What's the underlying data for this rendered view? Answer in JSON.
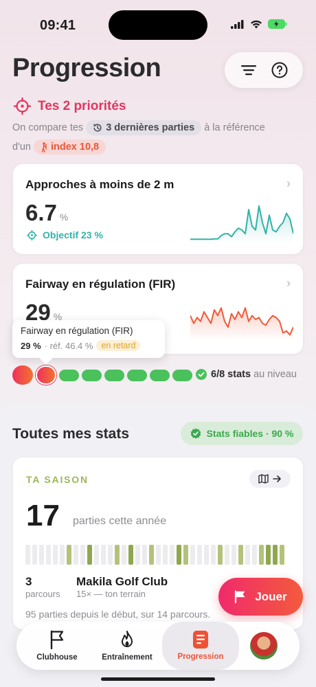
{
  "status": {
    "time": "09:41"
  },
  "header": {
    "title": "Progression"
  },
  "priorities": {
    "title": "Tes 2 priorités",
    "desc_prefix": "On compare tes",
    "recent_chip": "3 dernières parties",
    "desc_middle": "à la référence",
    "desc_line2": "d'un",
    "index_chip": "index 10,8"
  },
  "card1": {
    "title": "Approches à moins de 2 m",
    "value": "6.7",
    "unit": "%",
    "goal": "Objectif 23 %",
    "spark": [
      0.05,
      0.05,
      0.05,
      0.05,
      0.05,
      0.05,
      0.05,
      0.06,
      0.06,
      0.15,
      0.2,
      0.2,
      0.12,
      0.25,
      0.35,
      0.3,
      0.2,
      0.85,
      0.4,
      0.3,
      0.95,
      0.5,
      0.2,
      0.7,
      0.3,
      0.25,
      0.4,
      0.5,
      0.75,
      0.6,
      0.2
    ],
    "spark_color": "#2fb3a6"
  },
  "card2": {
    "title": "Fairway en régulation (FIR)",
    "value": "29",
    "unit": "%",
    "spark": [
      0.6,
      0.4,
      0.55,
      0.45,
      0.7,
      0.55,
      0.4,
      0.75,
      0.6,
      0.8,
      0.45,
      0.3,
      0.65,
      0.5,
      0.7,
      0.55,
      0.8,
      0.45,
      0.6,
      0.5,
      0.55,
      0.4,
      0.35,
      0.5,
      0.6,
      0.55,
      0.45,
      0.15,
      0.2,
      0.1,
      0.3
    ],
    "spark_color": "#ef5a3a"
  },
  "tooltip": {
    "title": "Fairway en régulation (FIR)",
    "value": "29 %",
    "ref": "· réf. 46.4 %",
    "status": "en retard"
  },
  "progress": {
    "statuses": [
      "bad",
      "bad",
      "good",
      "good",
      "good",
      "good",
      "good",
      "good"
    ],
    "label_bold": "6/8 stats",
    "label_rest": "au niveau"
  },
  "stats": {
    "title": "Toutes mes stats",
    "reliable": "Stats fiables · 90 %"
  },
  "season": {
    "label": "TA SAISON",
    "count": "17",
    "count_label": "parties cette année",
    "bars": [
      0,
      0,
      0,
      0,
      0,
      0,
      1,
      0,
      0,
      2,
      0,
      0,
      0,
      1,
      0,
      2,
      0,
      0,
      1,
      0,
      0,
      0,
      2,
      1,
      0,
      0,
      0,
      0,
      1,
      0,
      0,
      1,
      0,
      0,
      1,
      2,
      2,
      1
    ],
    "courses_count": "3",
    "courses_label": "parcours",
    "club_name": "Makila Golf Club",
    "club_sub": "15× — ton terrain",
    "footer": "95 parties depuis le début, sur 14 parcours."
  },
  "play_button": "Jouer",
  "tabs": [
    {
      "label": "Clubhouse",
      "icon": "flag-icon"
    },
    {
      "label": "Entraînement",
      "icon": "flame-icon"
    },
    {
      "label": "Progression",
      "icon": "document-icon",
      "active": true
    }
  ],
  "colors": {
    "accent": "#e2365e",
    "teal": "#2fb3a6",
    "green": "#4ac15b",
    "olive": "#9fb55a",
    "orange": "#ef5134"
  }
}
